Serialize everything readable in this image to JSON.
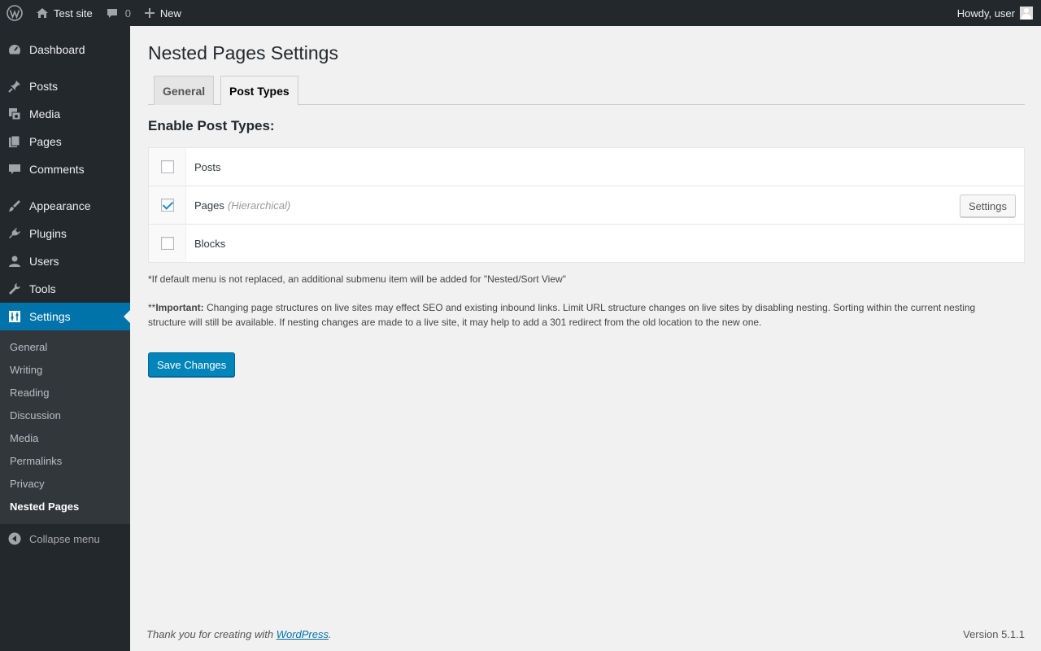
{
  "adminbar": {
    "site_name": "Test site",
    "comments_count": "0",
    "new_label": "New",
    "howdy": "Howdy, user"
  },
  "sidebar": {
    "items": [
      {
        "label": "Dashboard",
        "icon": "dashboard-icon"
      },
      {
        "label": "Posts",
        "icon": "pushpin-icon"
      },
      {
        "label": "Media",
        "icon": "media-icon"
      },
      {
        "label": "Pages",
        "icon": "pages-icon"
      },
      {
        "label": "Comments",
        "icon": "comment-icon"
      },
      {
        "label": "Appearance",
        "icon": "paintbrush-icon"
      },
      {
        "label": "Plugins",
        "icon": "plugin-icon"
      },
      {
        "label": "Users",
        "icon": "user-icon"
      },
      {
        "label": "Tools",
        "icon": "wrench-icon"
      },
      {
        "label": "Settings",
        "icon": "settings-icon"
      }
    ],
    "submenu": [
      "General",
      "Writing",
      "Reading",
      "Discussion",
      "Media",
      "Permalinks",
      "Privacy",
      "Nested Pages"
    ],
    "collapse_label": "Collapse menu"
  },
  "page": {
    "title": "Nested Pages Settings",
    "tabs": [
      "General",
      "Post Types"
    ],
    "section_heading": "Enable Post Types:",
    "post_types": [
      {
        "label": "Posts",
        "checked": false,
        "note": ""
      },
      {
        "label": "Pages",
        "checked": true,
        "note": "(Hierarchical)"
      },
      {
        "label": "Blocks",
        "checked": false,
        "note": ""
      }
    ],
    "settings_button": "Settings",
    "note_default_menu": "*If default menu is not replaced, an additional submenu item will be added for \"Nested/Sort View\"",
    "note_important_prefix": "**",
    "note_important_label": "Important:",
    "note_important_text": " Changing page structures on live sites may effect SEO and existing inbound links. Limit URL structure changes on live sites by disabling nesting. Sorting within the current nesting structure will still be available. If nesting changes are made to a live site, it may help to add a 301 redirect from the old location to the new one.",
    "save_button": "Save Changes"
  },
  "footer": {
    "thanks_prefix": "Thank you for creating with ",
    "thanks_link": "WordPress",
    "thanks_suffix": ".",
    "version": "Version 5.1.1"
  },
  "colors": {
    "adminbar_bg": "#23282d",
    "sidebar_bg": "#23282d",
    "submenu_bg": "#32373c",
    "accent": "#0073aa",
    "primary_button": "#0085ba",
    "page_bg": "#f1f1f1"
  }
}
